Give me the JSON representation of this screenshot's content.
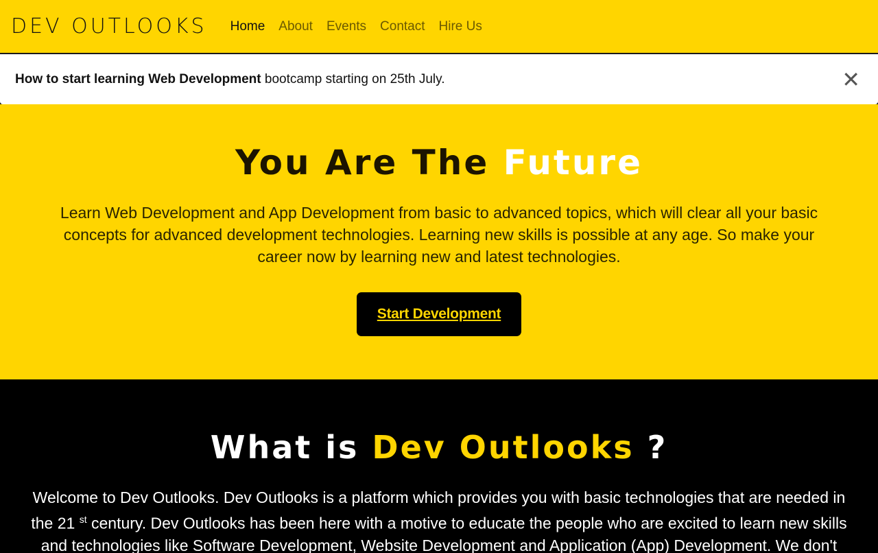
{
  "brand": {
    "logo_text": "DEV OUTLOOKS"
  },
  "nav": {
    "items": [
      {
        "label": "Home"
      },
      {
        "label": "About"
      },
      {
        "label": "Events"
      },
      {
        "label": "Contact"
      },
      {
        "label": "Hire Us"
      }
    ]
  },
  "alert": {
    "bold_text": "How to start learning Web Development",
    "text": " bootcamp starting on 25th July.",
    "close_icon": "close-icon"
  },
  "hero": {
    "title_main": "You Are The ",
    "title_accent": "Future",
    "description": "Learn Web Development and App Development from basic to advanced topics, which will clear all your basic concepts for advanced development technologies. Learning new skills is possible at any age. So make your career now by learning new and latest technologies.",
    "cta_label": "Start Development"
  },
  "about": {
    "title_main": "What is ",
    "title_accent": "Dev Outlooks",
    "title_end": " ?",
    "text_part1": "Welcome to Dev Outlooks. Dev Outlooks is a platform which provides you with basic technologies that are needed in the 21 ",
    "text_sup": "st",
    "text_part2": " century. Dev Outlooks has been here with a motive to educate the people who are excited to learn new skills and technologies like Software Development, Website Development and Application (App) Development. We don't just"
  },
  "colors": {
    "accent": "#ffd500",
    "dark": "#000000",
    "light": "#ffffff"
  }
}
